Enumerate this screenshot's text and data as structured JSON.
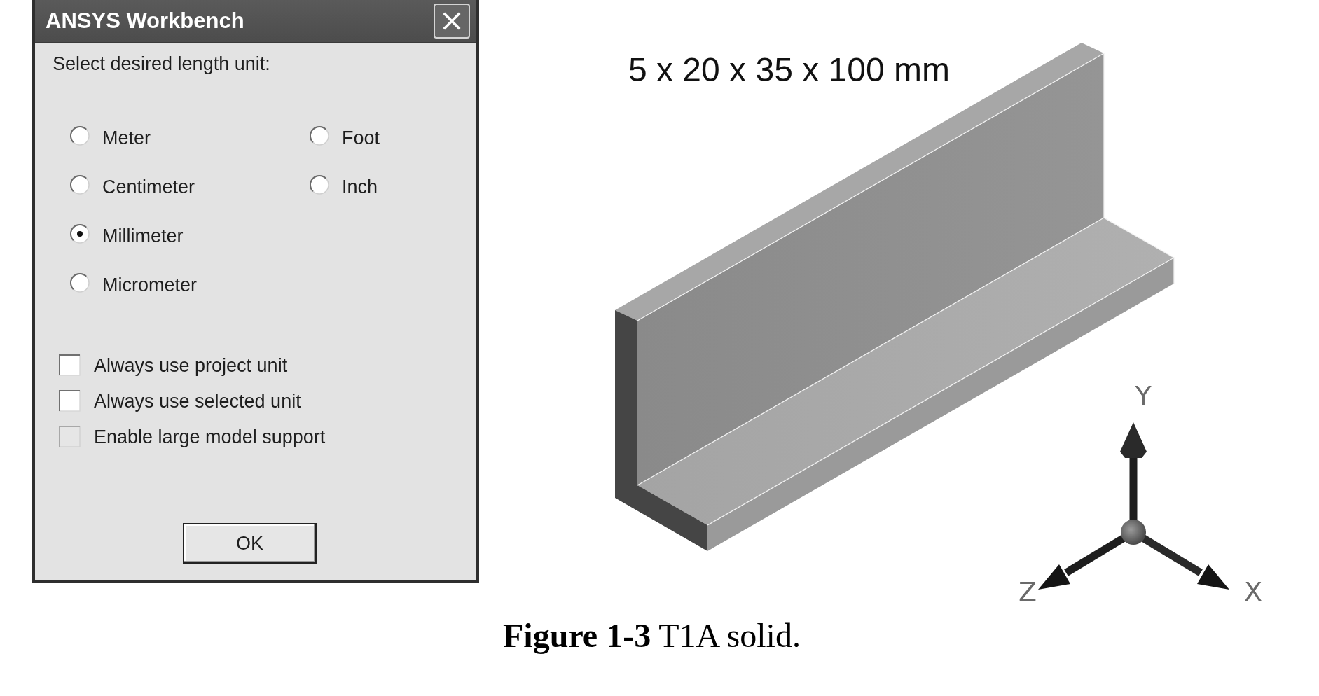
{
  "dialog": {
    "title": "ANSYS Workbench",
    "prompt": "Select desired length unit:",
    "units": [
      {
        "label": "Meter",
        "selected": false
      },
      {
        "label": "Centimeter",
        "selected": false
      },
      {
        "label": "Millimeter",
        "selected": true
      },
      {
        "label": "Micrometer",
        "selected": false
      },
      {
        "label": "Foot",
        "selected": false
      },
      {
        "label": "Inch",
        "selected": false
      }
    ],
    "options": [
      {
        "label": "Always use project unit",
        "checked": false,
        "disabled": false
      },
      {
        "label": "Always use selected unit",
        "checked": false,
        "disabled": false
      },
      {
        "label": "Enable large model support",
        "checked": false,
        "disabled": true
      }
    ],
    "ok_button": "OK"
  },
  "figure": {
    "dimension_label": "5 x 20 x 35 x 100 mm",
    "axis_labels": {
      "y": "Y",
      "z": "Z",
      "x": "X"
    }
  },
  "caption": "**Figure 1-3** T1A solid."
}
